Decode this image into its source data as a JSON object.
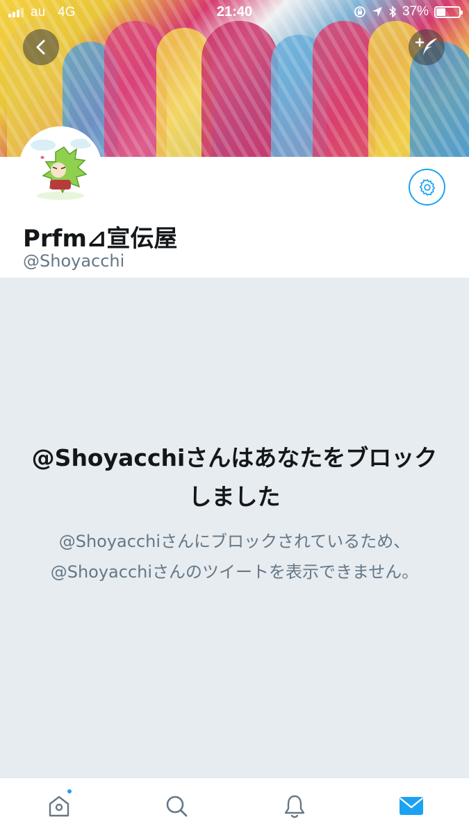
{
  "status_bar": {
    "carrier": "au",
    "network": "4G",
    "time": "21:40",
    "battery": "37%",
    "battery_level": 0.37
  },
  "header": {
    "back_icon": "chevron-left-icon",
    "compose_icon": "compose-tweet-icon"
  },
  "profile": {
    "display_name": "Prfm⊿宣伝屋",
    "handle": "@Shoyacchi",
    "settings_icon": "gear-icon"
  },
  "blocked": {
    "title": "@Shoyacchiさんはあなたをブロックしました",
    "description": "@Shoyacchiさんにブロックされているため、@Shoyacchiさんのツイートを表示できません。"
  },
  "tabbar": {
    "items": [
      {
        "icon": "home-icon",
        "has_badge": true
      },
      {
        "icon": "search-icon",
        "has_badge": false
      },
      {
        "icon": "bell-icon",
        "has_badge": false
      },
      {
        "icon": "mail-icon",
        "has_badge": false
      }
    ]
  },
  "colors": {
    "accent": "#1da1f2",
    "background": "#e6ecf0",
    "secondary_text": "#657786"
  }
}
